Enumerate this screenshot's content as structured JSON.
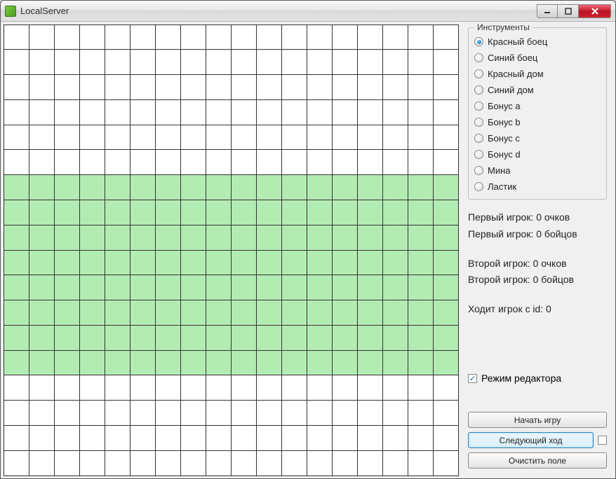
{
  "window": {
    "title": "LocalServer"
  },
  "grid": {
    "cols": 18,
    "rows": 18,
    "green_rows_start": 6,
    "green_rows_end": 13
  },
  "tools": {
    "group_title": "Инструменты",
    "selected_index": 0,
    "items": [
      "Красный боец",
      "Синий боец",
      "Красный дом",
      "Синий дом",
      "Бонус a",
      "Бонус b",
      "Бонус c",
      "Бонус d",
      "Мина",
      "Ластик"
    ]
  },
  "stats": {
    "p1_points": "Первый игрок: 0 очков",
    "p1_fighters": "Первый игрок: 0 бойцов",
    "p2_points": "Второй игрок: 0 очков",
    "p2_fighters": "Второй игрок: 0 бойцов",
    "turn": "Ходит игрок с id: 0"
  },
  "editor_mode": {
    "label": "Режим редактора",
    "checked": true
  },
  "buttons": {
    "start": "Начать игру",
    "next": "Следующий ход",
    "clear": "Очистить поле"
  }
}
